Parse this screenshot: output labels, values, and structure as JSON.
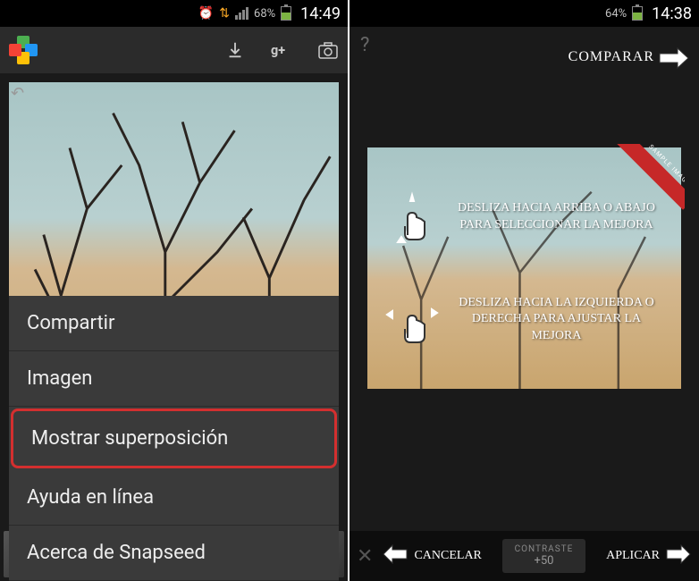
{
  "left": {
    "status": {
      "battery_pct": "68%",
      "time": "14:49"
    },
    "menu": {
      "items": [
        {
          "label": "Compartir"
        },
        {
          "label": "Imagen"
        },
        {
          "label": "Mostrar superposición",
          "highlighted": true
        },
        {
          "label": "Ayuda en línea"
        },
        {
          "label": "Acerca de Snapseed"
        }
      ]
    }
  },
  "right": {
    "status": {
      "battery_pct": "64%",
      "time": "14:38"
    },
    "compare_label": "COMPARAR",
    "sample_label": "SAMPLE IMAGE",
    "tutorial": {
      "text1": "DESLIZA HACIA ARRIBA O ABAJO PARA SELECCIONAR LA MEJORA",
      "text2": "DESLIZA HACIA LA IZQUIERDA O DERECHA PARA AJUSTAR LA MEJORA"
    },
    "bottom": {
      "cancel": "CANCELAR",
      "apply": "APLICAR",
      "adjust_label": "CONTRASTE",
      "adjust_value": "+50"
    }
  }
}
